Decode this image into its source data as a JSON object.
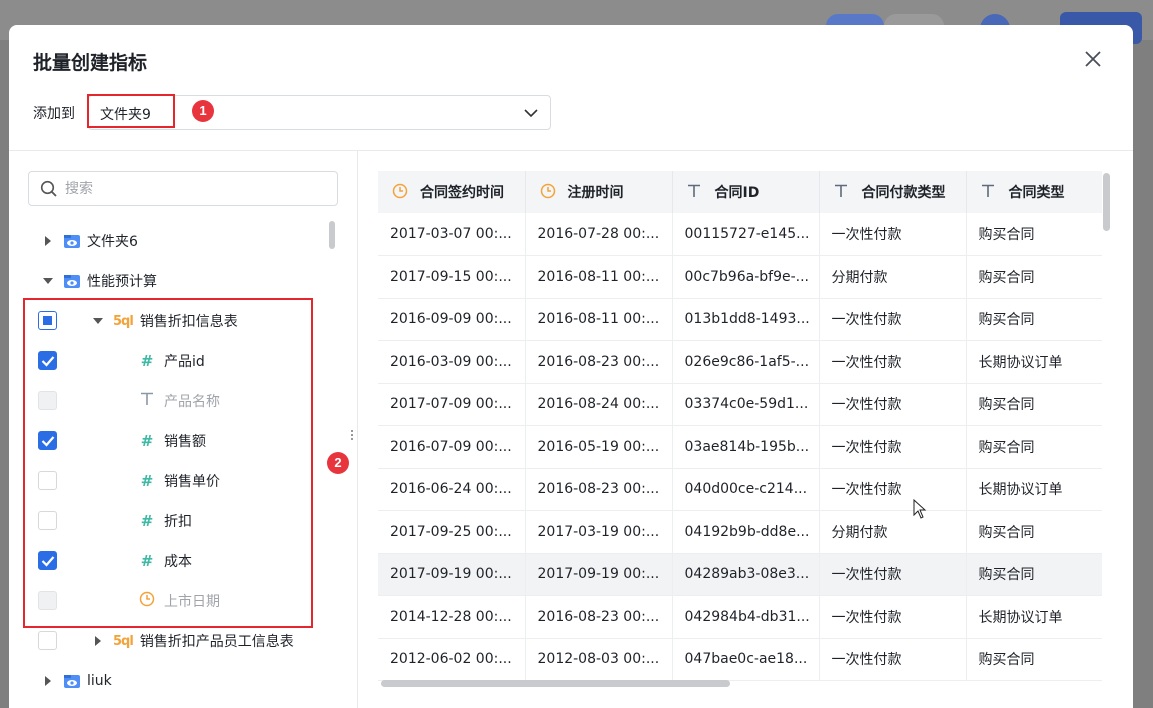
{
  "dialog": {
    "title": "批量创建指标",
    "add_to_label": "添加到",
    "folder_value": "文件夹9"
  },
  "annotations": {
    "badge1": "1",
    "badge2": "2",
    "highlight_color": "#e5272d"
  },
  "search": {
    "placeholder": "搜索"
  },
  "tree": {
    "folder6": "文件夹6",
    "perf": "性能预计算",
    "sales_table": "销售折扣信息表",
    "fields": [
      {
        "label": "产品id",
        "type": "number",
        "checked": true
      },
      {
        "label": "产品名称",
        "type": "text",
        "disabled": true
      },
      {
        "label": "销售额",
        "type": "number",
        "checked": true
      },
      {
        "label": "销售单价",
        "type": "number",
        "checked": false
      },
      {
        "label": "折扣",
        "type": "number",
        "checked": false
      },
      {
        "label": "成本",
        "type": "number",
        "checked": true
      },
      {
        "label": "上市日期",
        "type": "date",
        "disabled": true
      }
    ],
    "staff_table": "销售折扣产品员工信息表",
    "liuk": "liuk"
  },
  "table": {
    "headers": [
      "合同签约时间",
      "注册时间",
      "合同ID",
      "合同付款类型",
      "合同类型"
    ],
    "rows": [
      [
        "2017-03-07 00:...",
        "2016-07-28 00:...",
        "00115727-e145...",
        "一次性付款",
        "购买合同"
      ],
      [
        "2017-09-15 00:...",
        "2016-08-11 00:...",
        "00c7b96a-bf9e-...",
        "分期付款",
        "购买合同"
      ],
      [
        "2016-09-09 00:...",
        "2016-08-11 00:...",
        "013b1dd8-1493...",
        "一次性付款",
        "购买合同"
      ],
      [
        "2016-03-09 00:...",
        "2016-08-23 00:...",
        "026e9c86-1af5-...",
        "一次性付款",
        "长期协议订单"
      ],
      [
        "2017-07-09 00:...",
        "2016-08-24 00:...",
        "03374c0e-59d1...",
        "一次性付款",
        "购买合同"
      ],
      [
        "2016-07-09 00:...",
        "2016-05-19 00:...",
        "03ae814b-195b...",
        "一次性付款",
        "购买合同"
      ],
      [
        "2016-06-24 00:...",
        "2016-08-23 00:...",
        "040d00ce-c214...",
        "一次性付款",
        "长期协议订单"
      ],
      [
        "2017-09-25 00:...",
        "2017-03-19 00:...",
        "04192b9b-dd8e...",
        "分期付款",
        "购买合同"
      ],
      [
        "2017-09-19 00:...",
        "2017-09-19 00:...",
        "04289ab3-08e3...",
        "一次性付款",
        "购买合同"
      ],
      [
        "2014-12-28 00:...",
        "2016-08-23 00:...",
        "042984b4-db31...",
        "一次性付款",
        "长期协议订单"
      ],
      [
        "2012-06-02 00:...",
        "2012-08-03 00:...",
        "047bae0c-ae18...",
        "一次性付款",
        "购买合同"
      ]
    ]
  },
  "colors": {
    "accent": "#2b6de5",
    "number_icon": "#3fb8a5",
    "date_icon": "#f2a33a",
    "badge": "#e8343d"
  }
}
